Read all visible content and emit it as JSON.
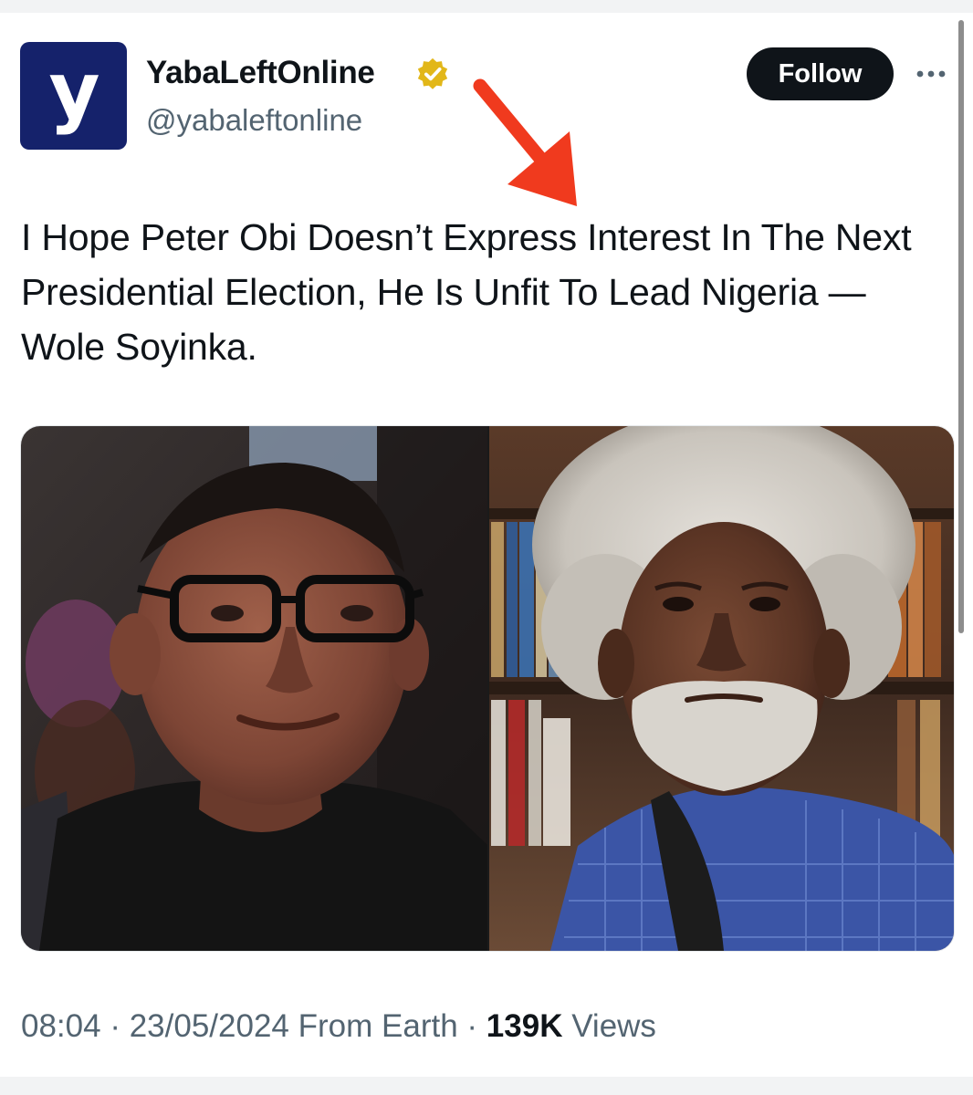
{
  "account": {
    "logo_letter": "y",
    "display_name": "YabaLeftOnline",
    "handle": "@yabaleftonline",
    "verified": true
  },
  "actions": {
    "follow_label": "Follow",
    "more_icon": "more-horizontal-icon"
  },
  "tweet": {
    "text": "I Hope Peter Obi Doesn’t Express Interest In The Next Presidential Election, He Is Unfit To Lead Nigeria — Wole Soyinka."
  },
  "meta": {
    "time": "08:04",
    "date": "23/05/2024",
    "source": "From Earth",
    "views_count": "139K",
    "views_label": "Views"
  },
  "colors": {
    "brand_navy": "#15226b",
    "verified_gold": "#e2b719",
    "annotation_red": "#f03a1e",
    "text_primary": "#0f1419",
    "text_secondary": "#536471"
  }
}
